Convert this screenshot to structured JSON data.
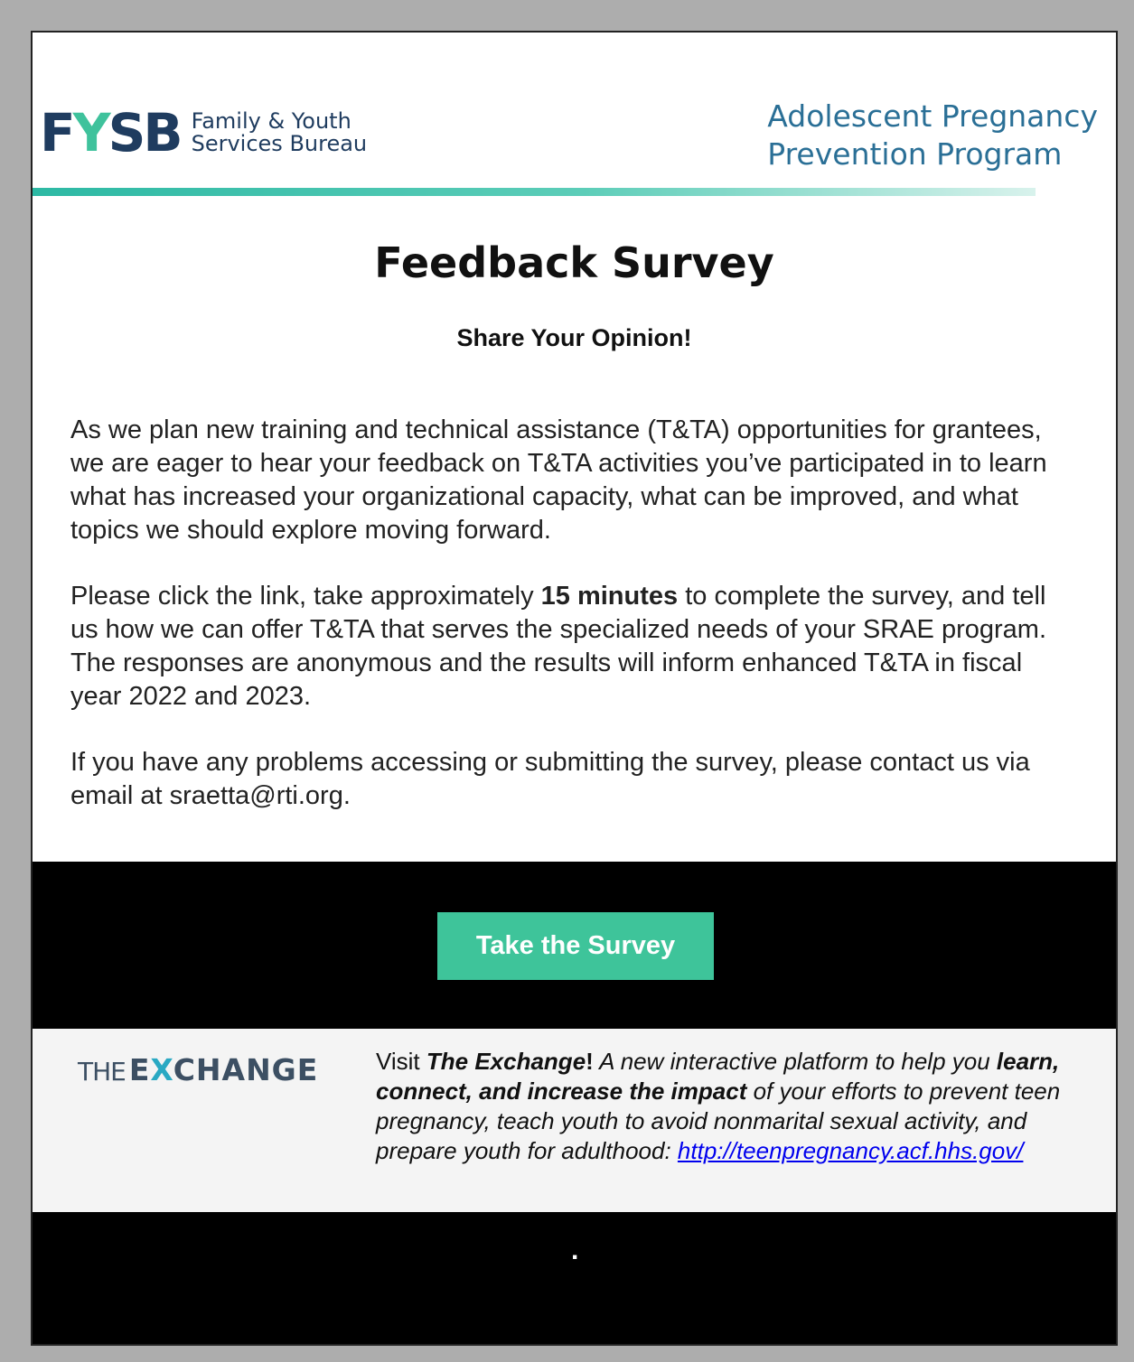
{
  "header": {
    "fysb_mark_f": "F",
    "fysb_mark_y": "Y",
    "fysb_mark_sb": "SB",
    "fysb_line1": "Family & Youth",
    "fysb_line2": "Services Bureau",
    "program_line1": "Adolescent Pregnancy",
    "program_line2": "Prevention Program",
    "accent_color": "#3fc29c"
  },
  "main": {
    "title": "Feedback Survey",
    "subtitle": "Share Your Opinion!",
    "paragraph1": "As we plan new training and technical assistance (T&TA) opportunities for grantees, we are eager to hear your feedback on T&TA activities you’ve participated in to learn what has increased your organizational capacity, what can be improved, and what topics we should explore moving forward.",
    "paragraph2_before": "Please click the link, take approximately ",
    "paragraph2_bold": "15 minutes",
    "paragraph2_after": " to complete the survey, and tell us how we can offer T&TA that serves the specialized needs of your SRAE program. The responses are anonymous and the results will inform enhanced T&TA in fiscal year 2022 and 2023.",
    "paragraph3": "If you have any problems accessing or submitting the survey, please contact us via email at sraetta@rti.org."
  },
  "cta": {
    "button_label": "Take the Survey",
    "button_color": "#3ec49a"
  },
  "exchange": {
    "logo_the": "THE",
    "logo_e": "E",
    "logo_x": "X",
    "logo_rest": "CHANGE",
    "visit": "Visit ",
    "name": "The Exchange",
    "bang": "!",
    "desc1": " A new interactive platform to help you ",
    "desc_bold": "learn, connect, and increase the impact",
    "desc2": " of your efforts to prevent teen pregnancy, teach youth to avoid nonmarital sexual activity, and prepare youth for adulthood: ",
    "link": "http://teenpregnancy.acf.hhs.gov/"
  },
  "footer": {
    "dot": "."
  }
}
